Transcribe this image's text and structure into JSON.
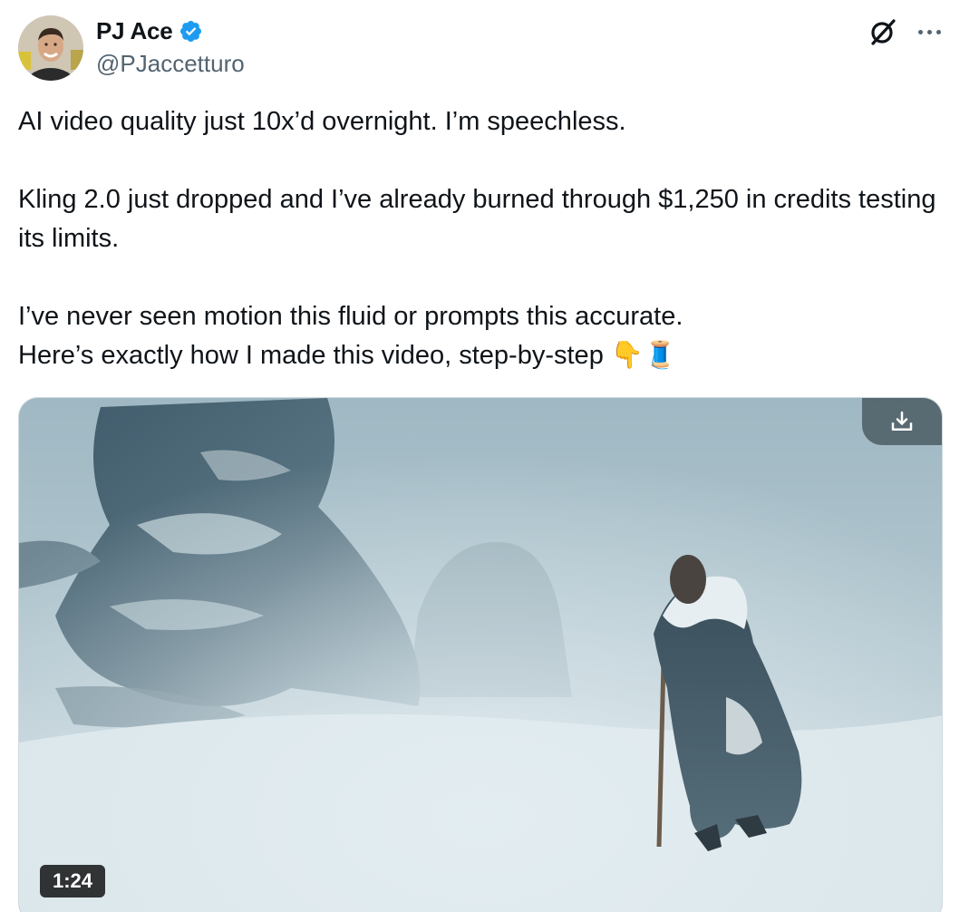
{
  "author": {
    "display_name": "PJ Ace",
    "handle": "@PJaccetturo",
    "avatar": "avatar-photo",
    "verified_icon": "verified-badge-icon",
    "verified_color": "#1d9bf0"
  },
  "header": {
    "grok_icon": "grok-icon",
    "more_icon": "more-options-icon"
  },
  "tweet": {
    "line1": "AI video quality just 10x’d overnight. I’m speechless.",
    "line2": "Kling 2.0 just dropped and I’ve already burned through $1,250 in credits testing its limits.",
    "line3": "I’ve never seen motion this fluid or prompts this accurate.",
    "line4": "Here’s exactly how I made this video, step-by-step 👇🧵"
  },
  "media": {
    "type": "video",
    "description_icon": "video-thumbnail",
    "duration": "1:24",
    "download_icon": "download-icon"
  },
  "colors": {
    "text_primary": "#0f1419",
    "text_secondary": "#536471",
    "border": "#cfd9de"
  }
}
